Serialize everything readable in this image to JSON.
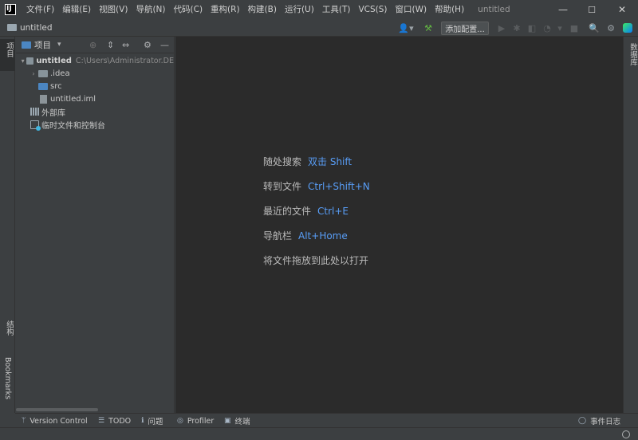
{
  "menubar": {
    "items": [
      "文件(F)",
      "编辑(E)",
      "视图(V)",
      "导航(N)",
      "代码(C)",
      "重构(R)",
      "构建(B)",
      "运行(U)",
      "工具(T)",
      "VCS(S)",
      "窗口(W)",
      "帮助(H)"
    ],
    "window_title": "untitled",
    "app_logo_text": "IJ",
    "minimize_glyph": "—",
    "maximize_glyph": "☐",
    "close_glyph": "✕"
  },
  "navbar": {
    "project_name": "untitled",
    "add_config_label": "添加配置...",
    "user_glyph": "👤▾",
    "build_glyph": "⚒",
    "run_glyph": "▶",
    "debug_glyph": "✱",
    "coverage_glyph": "◧",
    "profile_glyph": "◔",
    "more_glyph": "▾",
    "stop_glyph": "■",
    "search_glyph": "🔍",
    "settings_glyph": "⚙"
  },
  "left_strip": {
    "project_tab": "项目",
    "structure_tab": "结构",
    "bookmarks_tab": "Bookmarks"
  },
  "right_strip": {
    "database_tab": "数据库"
  },
  "project_panel": {
    "title": "项目",
    "dropdown_glyph": "▾",
    "locate_glyph": "⊕",
    "expand_glyph": "⇕",
    "collapse_glyph": "⇔",
    "gear_glyph": "⚙",
    "hide_glyph": "—",
    "tree": {
      "root": {
        "label": "untitled",
        "path": "C:\\Users\\Administrator.DE"
      },
      "idea": ".idea",
      "src": "src",
      "iml": "untitled.iml",
      "external_libs": "外部库",
      "scratches": "临时文件和控制台"
    },
    "expand_arrow": "▾",
    "collapse_arrow": "›"
  },
  "editor": {
    "hints": [
      {
        "label": "随处搜索",
        "shortcut": "双击 Shift"
      },
      {
        "label": "转到文件",
        "shortcut": "Ctrl+Shift+N"
      },
      {
        "label": "最近的文件",
        "shortcut": "Ctrl+E"
      },
      {
        "label": "导航栏",
        "shortcut": "Alt+Home"
      },
      {
        "label": "将文件拖放到此处以打开",
        "shortcut": ""
      }
    ]
  },
  "bottom_bar": {
    "version_control": "Version Control",
    "todo": "TODO",
    "problems": "问题",
    "profiler": "Profiler",
    "terminal": "终端",
    "event_log": "事件日志",
    "version_control_glyph": "ᛘ",
    "todo_glyph": "☰",
    "problems_glyph": "ℹ",
    "profiler_glyph": "◎",
    "terminal_glyph": "▣",
    "event_log_glyph": "◯"
  },
  "colors": {
    "accent_link": "#589df6",
    "editor_bg": "#2b2b2b",
    "panel_bg": "#3c3f41"
  }
}
